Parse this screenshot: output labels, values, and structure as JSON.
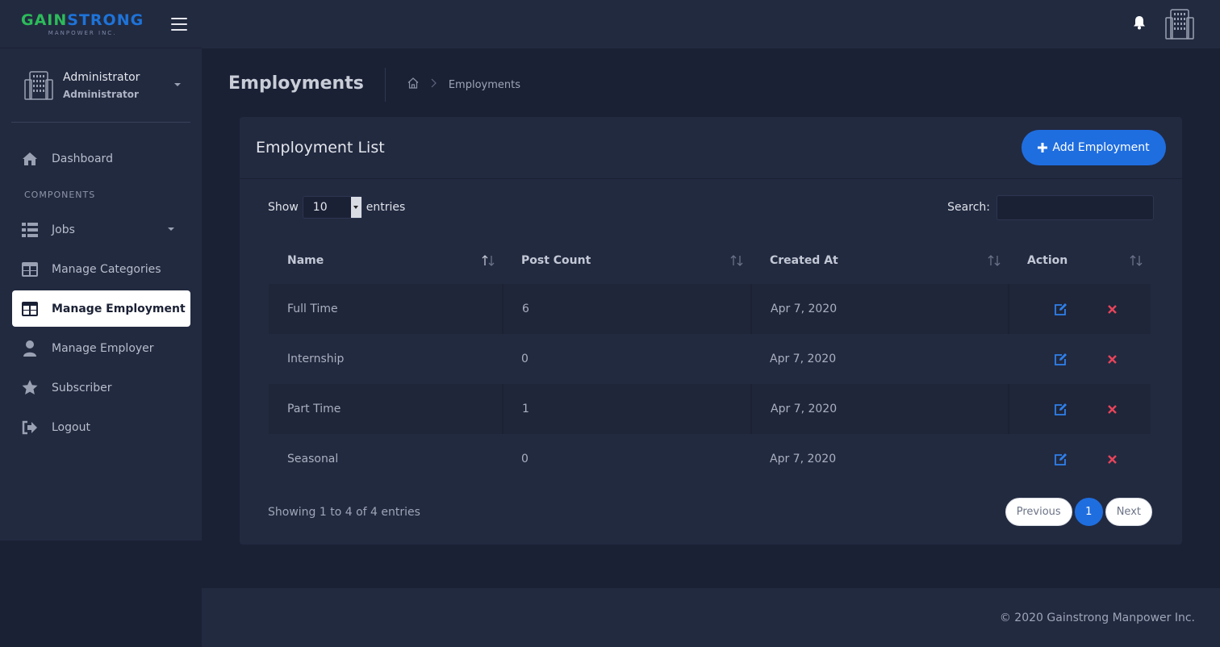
{
  "brand": {
    "name_part1": "GAIN",
    "name_part2": "STRONG",
    "tagline": "MANPOWER INC."
  },
  "user": {
    "name": "Administrator",
    "role": "Administrator"
  },
  "sidebar": {
    "section_label": "COMPONENTS",
    "items": [
      {
        "label": "Dashboard",
        "icon": "home-icon"
      },
      {
        "label": "Jobs",
        "icon": "list-icon"
      },
      {
        "label": "Manage Categories",
        "icon": "table-icon"
      },
      {
        "label": "Manage Employment",
        "icon": "table-icon"
      },
      {
        "label": "Manage Employer",
        "icon": "user-icon"
      },
      {
        "label": "Subscriber",
        "icon": "star-icon"
      },
      {
        "label": "Logout",
        "icon": "logout-icon"
      }
    ]
  },
  "page": {
    "title": "Employments",
    "breadcrumb_current": "Employments"
  },
  "card": {
    "title": "Employment List",
    "add_button": "Add Employment"
  },
  "controls": {
    "show_label": "Show",
    "page_size": "10",
    "entries_label": "entries",
    "search_label": "Search:"
  },
  "table": {
    "headers": [
      "Name",
      "Post Count",
      "Created At",
      "Action"
    ],
    "rows": [
      {
        "name": "Full Time",
        "count": "6",
        "created": "Apr 7, 2020"
      },
      {
        "name": "Internship",
        "count": "0",
        "created": "Apr 7, 2020"
      },
      {
        "name": "Part Time",
        "count": "1",
        "created": "Apr 7, 2020"
      },
      {
        "name": "Seasonal",
        "count": "0",
        "created": "Apr 7, 2020"
      }
    ]
  },
  "pagination": {
    "info": "Showing 1 to 4 of 4 entries",
    "previous": "Previous",
    "current": "1",
    "next": "Next"
  },
  "footer": {
    "copyright": "© 2020 Gainstrong Manpower Inc."
  },
  "colors": {
    "accent": "#1f6ee0",
    "delete": "#e8445a",
    "edit": "#2f80ed",
    "logo_green": "#2dbb5a",
    "logo_blue": "#1e73d8"
  }
}
